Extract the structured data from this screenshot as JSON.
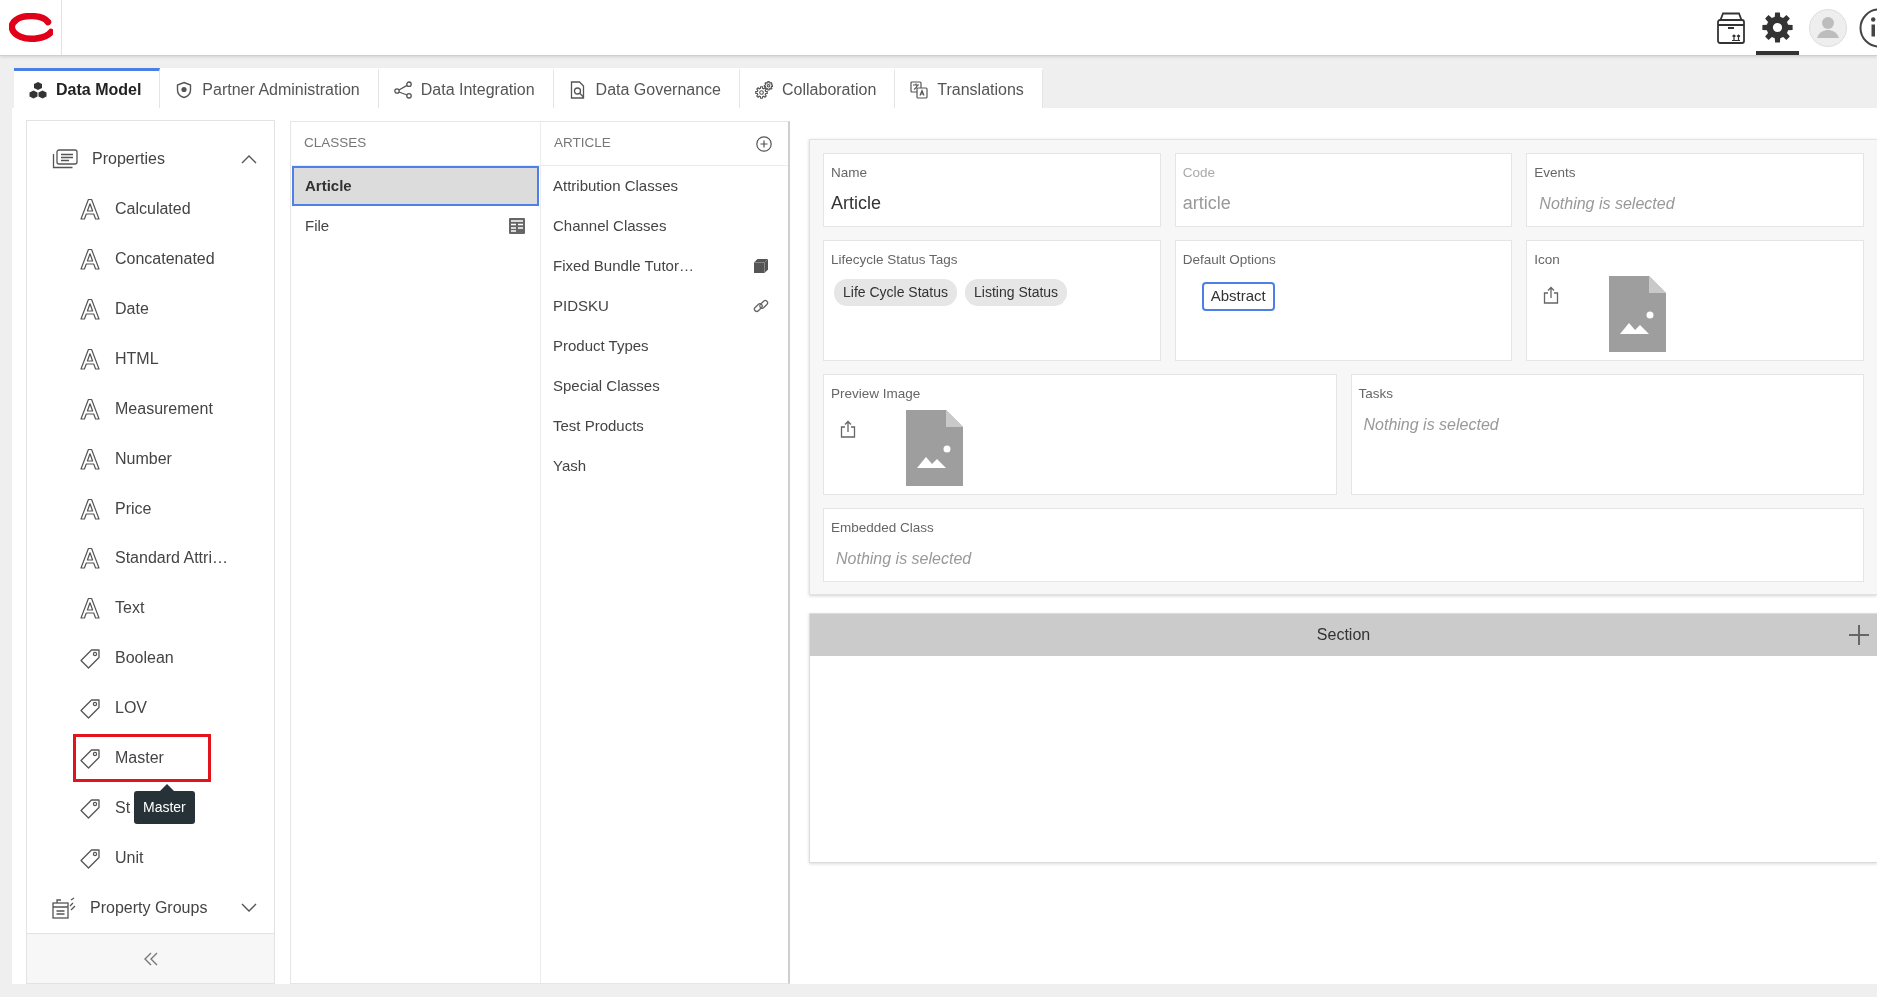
{
  "header": {
    "toolbar": [
      {
        "kind": "package",
        "selected": false
      },
      {
        "kind": "settings",
        "selected": true
      },
      {
        "kind": "account",
        "selected": false
      },
      {
        "kind": "info",
        "selected": false
      }
    ]
  },
  "tabs": [
    {
      "label": "Data Model",
      "selected": true
    },
    {
      "label": "Partner Administration",
      "selected": false
    },
    {
      "label": "Data Integration",
      "selected": false
    },
    {
      "label": "Data Governance",
      "selected": false
    },
    {
      "label": "Collaboration",
      "selected": false
    },
    {
      "label": "Translations",
      "selected": false
    }
  ],
  "sidebar": {
    "groups": [
      {
        "label": "Properties",
        "expanded": true,
        "items": [
          {
            "label": "Calculated",
            "kind": "attribute",
            "highlighted": false
          },
          {
            "label": "Concatenated",
            "kind": "attribute",
            "highlighted": false
          },
          {
            "label": "Date",
            "kind": "attribute",
            "highlighted": false
          },
          {
            "label": "HTML",
            "kind": "attribute",
            "highlighted": false
          },
          {
            "label": "Measurement",
            "kind": "attribute",
            "highlighted": false
          },
          {
            "label": "Number",
            "kind": "attribute",
            "highlighted": false
          },
          {
            "label": "Price",
            "kind": "attribute",
            "highlighted": false
          },
          {
            "label": "Standard Attri…",
            "kind": "attribute",
            "highlighted": false
          },
          {
            "label": "Text",
            "kind": "attribute",
            "highlighted": false
          },
          {
            "label": "Boolean",
            "kind": "tag",
            "highlighted": false
          },
          {
            "label": "LOV",
            "kind": "tag",
            "highlighted": false
          },
          {
            "label": "Master",
            "kind": "tag",
            "highlighted": true,
            "tooltip": "Master"
          },
          {
            "label": "St",
            "kind": "tag",
            "highlighted": false
          },
          {
            "label": "Unit",
            "kind": "tag",
            "highlighted": false
          }
        ]
      },
      {
        "label": "Property Groups",
        "expanded": false
      }
    ]
  },
  "classes": {
    "header": "CLASSES",
    "items": [
      {
        "label": "Article",
        "kind": "plain",
        "selected": true
      },
      {
        "label": "File",
        "kind": "form",
        "selected": false
      }
    ]
  },
  "subclasses": {
    "header": "ARTICLE",
    "items": [
      {
        "label": "Attribution Classes",
        "kind": "plain",
        "selected": false
      },
      {
        "label": "Channel Classes",
        "kind": "plain",
        "selected": false
      },
      {
        "label": "Fixed Bundle Tutor…",
        "kind": "bundle",
        "selected": false
      },
      {
        "label": "PIDSKU",
        "kind": "link",
        "selected": false
      },
      {
        "label": "Product Types",
        "kind": "plain",
        "selected": false
      },
      {
        "label": "Special Classes",
        "kind": "plain",
        "selected": false
      },
      {
        "label": "Test Products",
        "kind": "plain",
        "selected": false
      },
      {
        "label": "Yash",
        "kind": "plain",
        "selected": false
      }
    ]
  },
  "form": {
    "rows": [
      [
        {
          "kind": "text",
          "label": "Name",
          "value": "Article",
          "disabled": false
        },
        {
          "kind": "text",
          "label": "Code",
          "value": "article",
          "disabled": true
        },
        {
          "kind": "select",
          "label": "Events",
          "placeholder": "Nothing is selected"
        }
      ],
      [
        {
          "kind": "tags",
          "label": "Lifecycle Status Tags",
          "tags": [
            "Life Cycle Status",
            "Listing Status"
          ]
        },
        {
          "kind": "options",
          "label": "Default Options",
          "options": [
            {
              "label": "Abstract",
              "selected": true
            }
          ]
        },
        {
          "kind": "image",
          "label": "Icon"
        }
      ],
      [
        {
          "kind": "image",
          "label": "Preview Image"
        },
        {
          "kind": "select",
          "label": "Tasks",
          "placeholder": "Nothing is selected"
        }
      ],
      [
        {
          "kind": "select",
          "label": "Embedded Class",
          "placeholder": "Nothing is selected"
        }
      ]
    ]
  },
  "section": {
    "title": "Section"
  }
}
